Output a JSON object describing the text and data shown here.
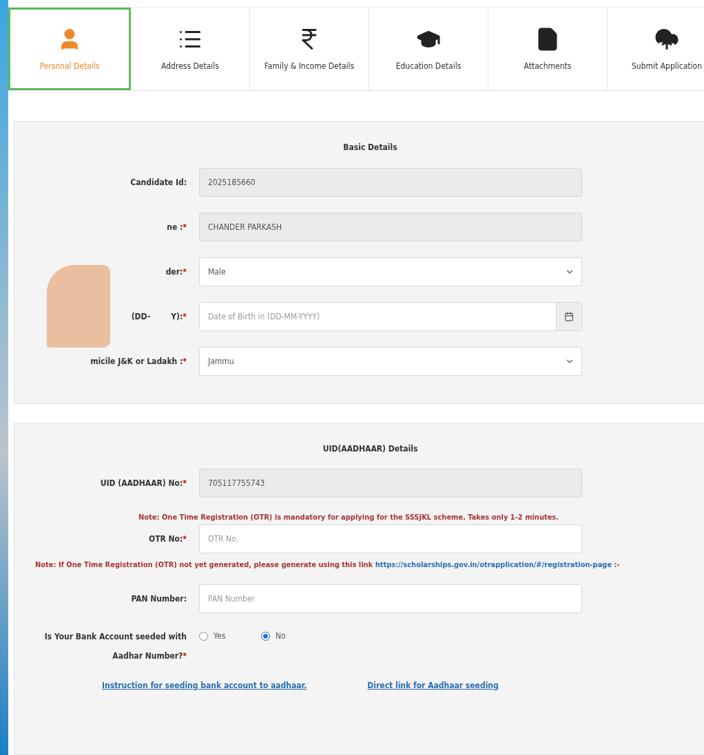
{
  "tabs": [
    {
      "label": "Personal Details",
      "selected": true
    },
    {
      "label": "Address Details",
      "selected": false
    },
    {
      "label": "Family & Income Details",
      "selected": false
    },
    {
      "label": "Education Details",
      "selected": false
    },
    {
      "label": "Attachments",
      "selected": false
    },
    {
      "label": "Submit Application",
      "selected": false
    }
  ],
  "basic_details": {
    "title": "Basic Details",
    "fields": [
      {
        "label_parts": [
          "Candidate Id:"
        ],
        "kind": "readonly",
        "value": "2025185660"
      },
      {
        "label_parts": [
          "ne :"
        ],
        "mark": "*",
        "kind": "readonly",
        "value": "CHANDER PARKASH"
      },
      {
        "label_parts": [
          "der:"
        ],
        "mark": "*",
        "kind": "select",
        "value": "Male"
      },
      {
        "label_parts": [
          "(DD-",
          "Y):"
        ],
        "mark": "*",
        "kind": "date",
        "placeholder": "Date of Birth in (DD-MM-YYYY)"
      },
      {
        "label_parts": [
          "micile J&K or Ladakh :"
        ],
        "mark": "*",
        "kind": "select",
        "value": "Jammu"
      }
    ]
  },
  "uid_details": {
    "title": "UID(AADHAAR) Details",
    "uid": {
      "label": "UID (AADHAAR) No:",
      "mark": "*",
      "value": "705117755743"
    },
    "otr_note": "Note: One Time Registration (OTR) is mandatory for applying for the SSSJKL scheme. Takes only 1-2 minutes.",
    "otr": {
      "label": "OTR No:",
      "mark": "*",
      "placeholder": "OTR No."
    },
    "link_note": {
      "text": "Note: If One Time Registration (OTR) not yet generated, please generate using this link",
      "link": "https://scholarships.gov.in/otrapplication/#/registration-page",
      "after": ":-"
    },
    "pan": {
      "label": "PAN Number:",
      "placeholder": "PAN Number"
    },
    "bank_seeded": {
      "label_lines": [
        "Is Your Bank Account seeded with",
        "Aadhar Number?"
      ],
      "mark": "*",
      "options": [
        {
          "label": "Yes",
          "selected": false
        },
        {
          "label": "No",
          "selected": true
        }
      ]
    },
    "links": [
      "Instruction for seeding bank account to aadhaar.",
      "Direct link for Aadhaar seeding"
    ]
  }
}
